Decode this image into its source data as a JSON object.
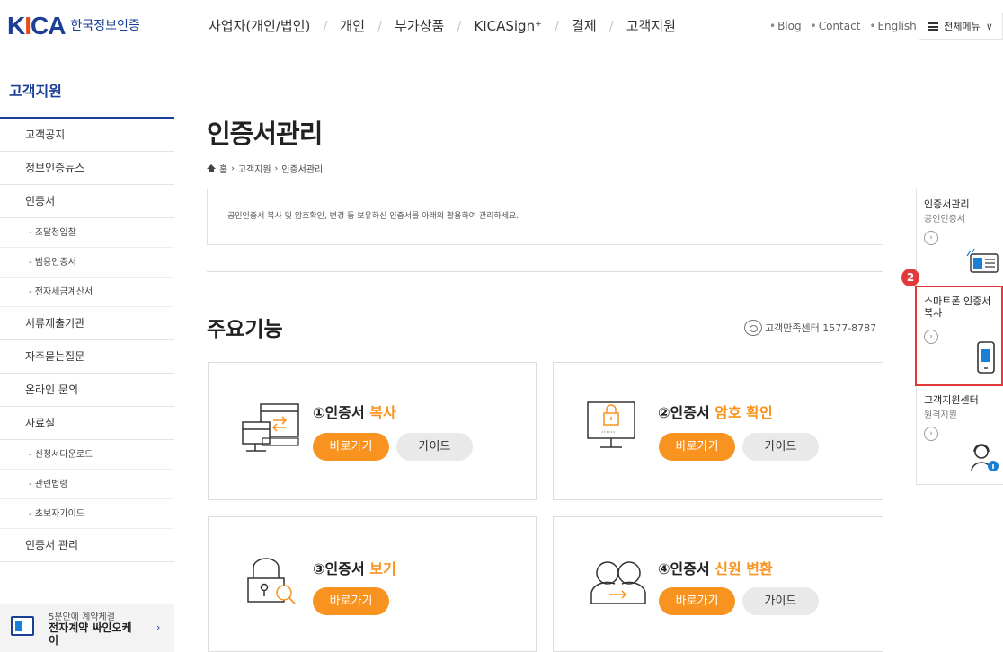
{
  "header": {
    "logo_text": "KICA",
    "logo_sub": "한국정보인증",
    "gnb": [
      "사업자(개인/법인)",
      "개인",
      "부가상품",
      "KICASign⁺",
      "결제",
      "고객지원"
    ],
    "util": [
      "Blog",
      "Contact",
      "English"
    ],
    "all_menu_label": "전체메뉴"
  },
  "sidebar": {
    "title": "고객지원",
    "items": [
      {
        "label": "고객공지",
        "type": "main"
      },
      {
        "label": "정보인증뉴스",
        "type": "main"
      },
      {
        "label": "인증서",
        "type": "main"
      },
      {
        "label": "- 조달청입찰",
        "type": "sub"
      },
      {
        "label": "- 범용인증서",
        "type": "sub"
      },
      {
        "label": "- 전자세금계산서",
        "type": "sub"
      },
      {
        "label": "서류제출기관",
        "type": "main"
      },
      {
        "label": "자주묻는질문",
        "type": "main"
      },
      {
        "label": "온라인 문의",
        "type": "main"
      },
      {
        "label": "자료실",
        "type": "main"
      },
      {
        "label": "- 신청서다운로드",
        "type": "sub"
      },
      {
        "label": "- 관련법령",
        "type": "sub"
      },
      {
        "label": "- 초보자가이드",
        "type": "sub"
      },
      {
        "label": "인증서 관리",
        "type": "main"
      }
    ],
    "banner": {
      "small": "5분안에 계약체결",
      "big": "전자계약 싸인오케이",
      "arrow": "›"
    }
  },
  "main": {
    "title": "인증서관리",
    "breadcrumb": [
      "홈",
      "고객지원",
      "인증서관리"
    ],
    "intro": "공인인증서 복사 및 암호확인, 변경 등 보유하신 인증서를 아래의 활용하여 관리하세요.",
    "section_title": "주요기능",
    "cs_phone": "고객만족센터 1577-8787",
    "cards": [
      {
        "num": "①인증서 ",
        "hl": "복사",
        "go": "바로가기",
        "guide": "가이드"
      },
      {
        "num": "②인증서 ",
        "hl": "암호 확인",
        "go": "바로가기",
        "guide": "가이드"
      },
      {
        "num": "③인증서 ",
        "hl": "보기",
        "go": "바로가기",
        "guide": ""
      },
      {
        "num": "④인증서 ",
        "hl": "신원 변환",
        "go": "바로가기",
        "guide": "가이드"
      }
    ]
  },
  "quick": {
    "badge": "2",
    "items": [
      {
        "title": "인증서관리",
        "sub": "공인인증서"
      },
      {
        "title": "스마트폰 인증서 복사",
        "sub": ""
      },
      {
        "title": "고객지원센터",
        "sub": "원격지원"
      }
    ],
    "arrow": "›"
  },
  "colors": {
    "brand": "#1b3f95",
    "accent": "#f7931e",
    "highlight": "#e23a3a"
  }
}
